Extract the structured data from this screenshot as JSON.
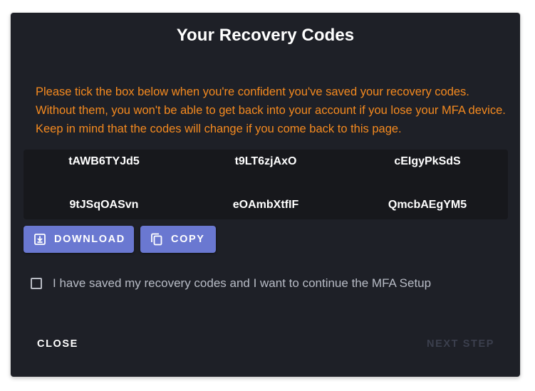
{
  "dialog": {
    "title": "Your Recovery Codes",
    "warning": "Please tick the box below when you're confident you've saved your recovery codes. Without them, you won't be able to get back into your account if you lose your MFA device. Keep in mind that the codes will change if you come back to this page.",
    "codes": [
      "tAWB6TYJd5",
      "t9LT6zjAxO",
      "cEIgyPkSdS",
      "9tJSqOASvn",
      "eOAmbXtfIF",
      "QmcbAEgYM5"
    ],
    "download_label": "DOWNLOAD",
    "copy_label": "COPY",
    "checkbox_label": "I have saved my recovery codes and I want to continue the MFA Setup",
    "close_label": "CLOSE",
    "next_label": "NEXT STEP"
  },
  "colors": {
    "background": "#1e2027",
    "warning": "#f58a1f",
    "button": "#6a78d1",
    "disabled_text": "#3b3f4d"
  },
  "icons": {
    "download": "download-icon",
    "copy": "copy-icon"
  }
}
